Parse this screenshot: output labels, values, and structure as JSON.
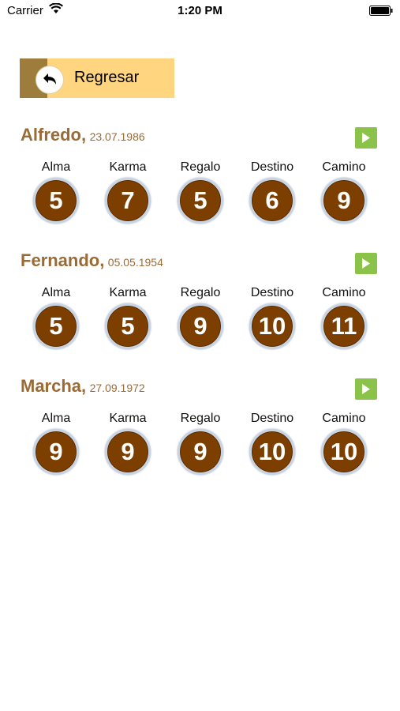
{
  "status_bar": {
    "carrier": "Carrier",
    "time": "1:20 PM"
  },
  "back_button": {
    "label": "Regresar",
    "icon": "back-arrow-icon"
  },
  "people": [
    {
      "name": "Alfredo,",
      "date": "23.07.1986",
      "numbers": [
        {
          "label": "Alma",
          "value": "5"
        },
        {
          "label": "Karma",
          "value": "7"
        },
        {
          "label": "Regalo",
          "value": "5"
        },
        {
          "label": "Destino",
          "value": "6"
        },
        {
          "label": "Camino",
          "value": "9"
        }
      ]
    },
    {
      "name": "Fernando,",
      "date": "05.05.1954",
      "numbers": [
        {
          "label": "Alma",
          "value": "5"
        },
        {
          "label": "Karma",
          "value": "5"
        },
        {
          "label": "Regalo",
          "value": "9"
        },
        {
          "label": "Destino",
          "value": "10"
        },
        {
          "label": "Camino",
          "value": "11"
        }
      ]
    },
    {
      "name": "Marcha,",
      "date": "27.09.1972",
      "numbers": [
        {
          "label": "Alma",
          "value": "9"
        },
        {
          "label": "Karma",
          "value": "9"
        },
        {
          "label": "Regalo",
          "value": "9"
        },
        {
          "label": "Destino",
          "value": "10"
        },
        {
          "label": "Camino",
          "value": "10"
        }
      ]
    }
  ],
  "colors": {
    "accent": "#9a6b35",
    "button_bg": "#ffd57f",
    "play": "#8bc34a",
    "circle": "#7d3f00"
  }
}
